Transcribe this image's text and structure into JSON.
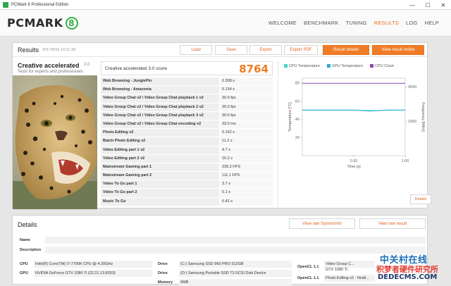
{
  "window": {
    "title": "PCMark 8 Professional Edition",
    "minimize": "—",
    "maximize": "☐",
    "close": "✕"
  },
  "logo": {
    "text": "PCMARK",
    "badge": "8"
  },
  "nav": [
    "WELCOME",
    "BENCHMARK",
    "TUNING",
    "RESULTS",
    "LOG",
    "HELP"
  ],
  "nav_active": "RESULTS",
  "results": {
    "title": "Results",
    "date": "2017/8/16 19:11:38",
    "buttons": {
      "load": "Load",
      "save": "Save",
      "export": "Export",
      "export_pdf": "Export PDF",
      "result_details": "Result details",
      "view_online": "View result online"
    },
    "test_name": "Creative accelerated",
    "test_version": "3.0",
    "test_subtitle": "Tests for experts and professionals",
    "score_label": "Creative accelerated 3.0 score",
    "score_value": "8764",
    "rows": [
      {
        "k": "Web Browsing - JunglePin",
        "v": "0.308 s"
      },
      {
        "k": "Web Browsing - Amazonia",
        "v": "0.134 s"
      },
      {
        "k": "Video Group Chat v2 / Video Group Chat playback 1 v2",
        "v": "30.0 fps"
      },
      {
        "k": "Video Group Chat v2 / Video Group Chat playback 2 v2",
        "v": "30.0 fps"
      },
      {
        "k": "Video Group Chat v2 / Video Group Chat playback 3 v2",
        "v": "30.0 fps"
      },
      {
        "k": "Video Group Chat v2 / Video Group Chat encoding v2",
        "v": "33.0 ms"
      },
      {
        "k": "Photo Editing v2",
        "v": "0.152 s"
      },
      {
        "k": "Batch Photo Editing v2",
        "v": "11.2 s"
      },
      {
        "k": "Video Editing part 1 v2",
        "v": "4.7 s"
      },
      {
        "k": "Video Editing part 2 v2",
        "v": "10.2 s"
      },
      {
        "k": "Mainstream Gaming part 1",
        "v": "239.2 FPS"
      },
      {
        "k": "Mainstream Gaming part 2",
        "v": "111.1 FPS"
      },
      {
        "k": "Video To Go part 1",
        "v": "3.7 s"
      },
      {
        "k": "Video To Go part 2",
        "v": "5.1 s"
      },
      {
        "k": "Music To Go",
        "v": "6.42 s"
      }
    ],
    "details_button": "Details"
  },
  "chart_data": {
    "type": "line",
    "series": [
      {
        "name": "CPU Temperature",
        "color": "#44d4c4",
        "axis": "left",
        "x": [
          0,
          0.16,
          0.33,
          0.5,
          0.66,
          0.83,
          1.0
        ],
        "values": [
          50,
          50,
          50,
          50,
          49.5,
          49.8,
          50
        ]
      },
      {
        "name": "GPU Temperature",
        "color": "#2aa8e0",
        "axis": "left",
        "x": [
          0,
          0.16,
          0.33,
          0.5,
          0.66,
          0.83,
          1.0
        ],
        "values": [
          50,
          50,
          50,
          50,
          49,
          50,
          50
        ]
      },
      {
        "name": "CPU Clock",
        "color": "#8e44ad",
        "axis": "right",
        "x": [
          0,
          0.16,
          0.33,
          0.5,
          0.66,
          0.83,
          1.0
        ],
        "values": [
          4200,
          4200,
          4200,
          4200,
          4200,
          4200,
          4200
        ]
      }
    ],
    "xlabel": "Time [s]",
    "ylabel_left": "Temperature [°C]",
    "ylabel_right": "Frequency [MHz]",
    "xticks": [
      "0:30",
      "1:00"
    ],
    "xticks_at": [
      0.5,
      1.0
    ],
    "yticks_left": [
      20,
      40,
      60,
      80
    ],
    "yticks_right": [
      2000,
      4000
    ],
    "ylim_left": [
      0,
      85
    ],
    "ylim_right": [
      0,
      4500
    ],
    "xlim": [
      0,
      1.0
    ],
    "legend_position": "top"
  },
  "details": {
    "title": "Details",
    "view_raw_systeminfo": "View raw SystemInfo",
    "view_raw_result": "View raw result",
    "labels": {
      "name": "Name",
      "description": "Description",
      "cpu": "CPU",
      "gpu": "GPU",
      "drive": "Drive",
      "drive2": "Drive",
      "memory": "Memory",
      "opencl1": "OpenCL 1.1",
      "opencl2": "OpenCL 1.1"
    },
    "values": {
      "cpu": "Intel(R) Core(TM) i7-7700K CPU @ 4.20GHz",
      "gpu": "NVIDIA GeForce GTX 1080 Ti (22.21.13.8253)",
      "drive1": "(C:) Samsung SSD 960 PRO 512GB",
      "drive2": "(D:) Samsung Portable SSD T3 SCSI Disk Device",
      "memory": "0MB",
      "opencl1_a": "Video Group C...",
      "opencl1_b": "GTX 1080 Ti",
      "opencl2": "Photo Editing v2 - Nvidi..."
    }
  },
  "watermark": {
    "cn": "中关村在线",
    "en": "积梦者硬件研究所",
    "url": "DEDECMS.COM"
  }
}
